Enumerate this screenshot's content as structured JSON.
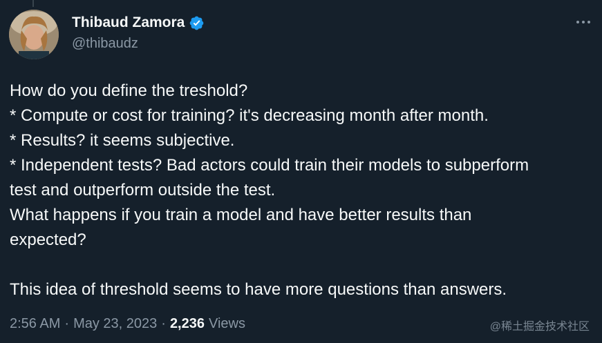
{
  "tweet": {
    "author": {
      "display_name": "Thibaud Zamora",
      "handle": "@thibaudz",
      "verified": true,
      "verified_color": "#1d9bf0"
    },
    "lines": [
      "How do you define the treshold?",
      "* Compute or cost for training? it's decreasing month after month.",
      "* Results? it seems subjective.",
      "* Independent tests? Bad actors could train their models to subperform",
      "test and outperform outside the test.",
      "What happens if you train a model and have better results than",
      "expected?",
      "",
      "This idea of threshold seems to have more questions than answers."
    ],
    "meta": {
      "time": "2:56 AM",
      "separator": "·",
      "date": "May 23, 2023",
      "views_count": "2,236",
      "views_label": "Views"
    },
    "icons": {
      "more": "more-horizontal-icon",
      "verified": "verified-badge-icon"
    }
  },
  "watermark": "@稀土掘金技术社区",
  "colors": {
    "background": "#15202b",
    "text_primary": "#f7f9f9",
    "text_secondary": "#8b98a5",
    "accent": "#1d9bf0"
  }
}
